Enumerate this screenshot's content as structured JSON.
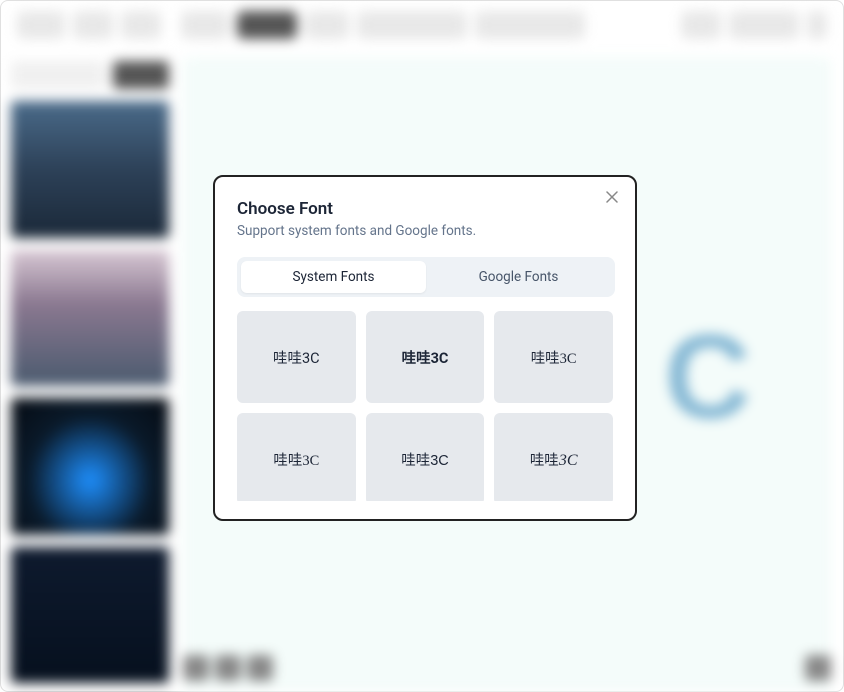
{
  "toolbar": {
    "items": [
      "file",
      "image",
      "text",
      "share",
      "export",
      "size",
      "weight",
      "font",
      "download"
    ]
  },
  "sidebar": {
    "search_placeholder": "Nature, Light",
    "search_button": "Search"
  },
  "canvas": {
    "sample_glyph": "C"
  },
  "modal": {
    "title": "Choose Font",
    "subtitle": "Support system fonts and Google fonts.",
    "tabs": {
      "system": "System Fonts",
      "google": "Google Fonts",
      "active": "system"
    },
    "sample_text": "哇哇3C",
    "fonts": [
      {
        "style": "normal"
      },
      {
        "style": "bold"
      },
      {
        "style": "serif"
      },
      {
        "style": "serif-light"
      },
      {
        "style": "rounded"
      },
      {
        "style": "script"
      },
      {
        "style": "normal2"
      },
      {
        "style": "normal3"
      },
      {
        "style": "normal4"
      }
    ]
  }
}
